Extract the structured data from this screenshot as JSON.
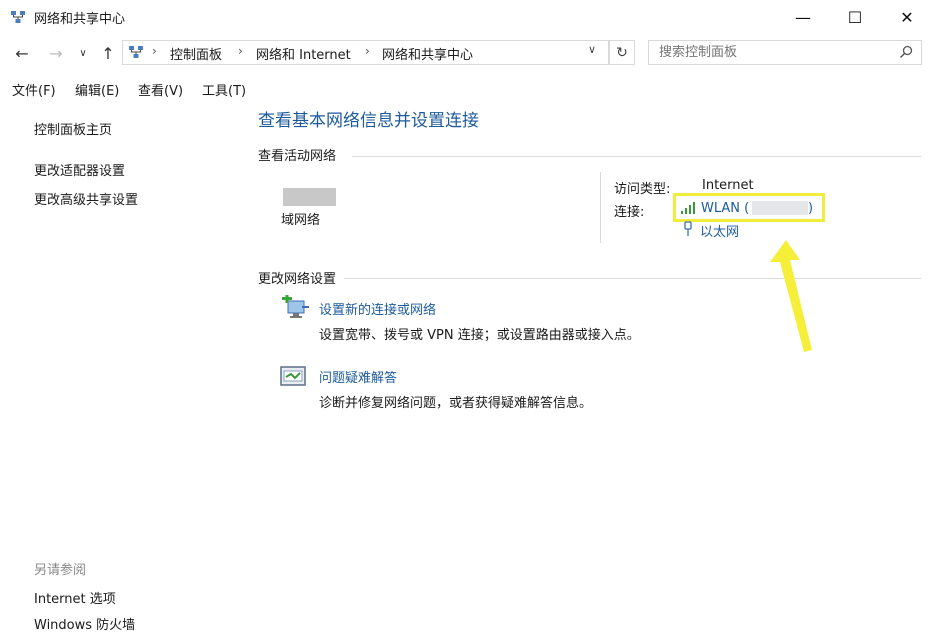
{
  "window": {
    "title": "网络和共享中心",
    "minimize": "—",
    "maximize": "☐",
    "close": "✕"
  },
  "nav": {
    "back": "←",
    "forward": "→",
    "recent": "∨",
    "up": "↑"
  },
  "address": {
    "separator": "›",
    "crumbs": [
      "控制面板",
      "网络和 Internet",
      "网络和共享中心"
    ],
    "dropdown": "∨",
    "refresh": "↻"
  },
  "search": {
    "placeholder": "搜索控制面板"
  },
  "menu": [
    "文件(F)",
    "编辑(E)",
    "查看(V)",
    "工具(T)"
  ],
  "left": {
    "home": "控制面板主页",
    "adapter": "更改适配器设置",
    "advanced": "更改高级共享设置",
    "see_also": "另请参阅",
    "internet_options": "Internet 选项",
    "firewall": "Windows 防火墙"
  },
  "main": {
    "title": "查看基本网络信息并设置连接",
    "active_heading": "查看活动网络",
    "network_name": "域网络",
    "access_type_label": "访问类型:",
    "access_type_value": "Internet",
    "connection_label": "连接:",
    "wlan": "WLAN (",
    "wlan_close": ")",
    "ethernet": "以太网",
    "change_heading": "更改网络设置",
    "new_connection_link": "设置新的连接或网络",
    "new_connection_desc": "设置宽带、拨号或 VPN 连接；或设置路由器或接入点。",
    "troubleshoot_link": "问题疑难解答",
    "troubleshoot_desc": "诊断并修复网络问题，或者获得疑难解答信息。"
  },
  "colors": {
    "link": "#1c5a9b",
    "highlight": "#f2ec3a",
    "arrow": "#f5ef3a"
  },
  "icons": {
    "title": "network-icon",
    "address": "network-icon",
    "search": "search-icon",
    "wifi": "wifi-signal-icon",
    "ethernet": "ethernet-icon",
    "new_connection": "new-connection-icon",
    "troubleshoot": "troubleshoot-icon"
  }
}
